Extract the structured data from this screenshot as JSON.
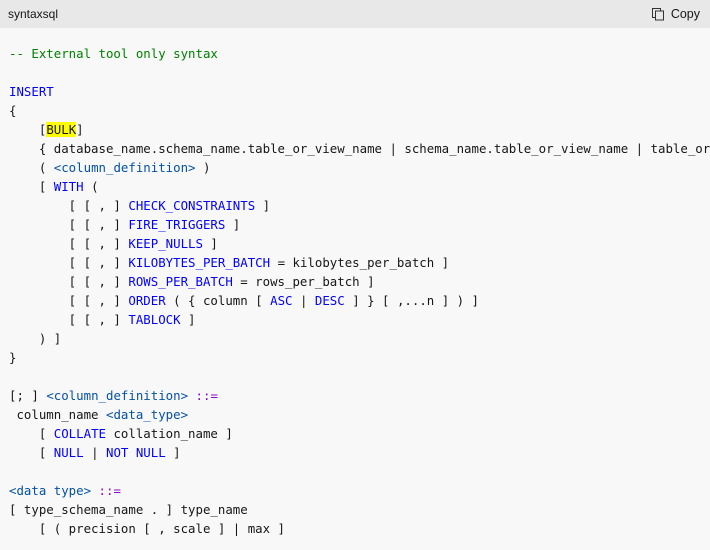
{
  "header": {
    "language": "syntaxsql",
    "copy_label": "Copy"
  },
  "icons": {
    "copy": "copy-icon"
  },
  "colors": {
    "comment": "#008000",
    "keyword": "#0101fd",
    "type": "#0451a5",
    "operator": "#8f08c4",
    "highlight": "#ffff00",
    "text": "#171717",
    "header_bg": "#e8e8e8",
    "code_bg": "#f8f8f8"
  },
  "code_lines": [
    [
      [
        "c",
        "-- External tool only syntax"
      ]
    ],
    [],
    [
      [
        "k",
        "INSERT"
      ]
    ],
    [
      [
        "t",
        "{"
      ]
    ],
    [
      [
        "t",
        "    ["
      ],
      [
        "h",
        "BULK"
      ],
      [
        "t",
        "]"
      ]
    ],
    [
      [
        "t",
        "    { database_name.schema_name.table_or_view_name | schema_name.table_or_view_name | table_or_view_name }"
      ]
    ],
    [
      [
        "t",
        "    ( "
      ],
      [
        "y",
        "<column_definition>"
      ],
      [
        "t",
        " )"
      ]
    ],
    [
      [
        "t",
        "    [ "
      ],
      [
        "k",
        "WITH"
      ],
      [
        "t",
        " ("
      ]
    ],
    [
      [
        "t",
        "        [ [ , ] "
      ],
      [
        "k",
        "CHECK_CONSTRAINTS"
      ],
      [
        "t",
        " ]"
      ]
    ],
    [
      [
        "t",
        "        [ [ , ] "
      ],
      [
        "k",
        "FIRE_TRIGGERS"
      ],
      [
        "t",
        " ]"
      ]
    ],
    [
      [
        "t",
        "        [ [ , ] "
      ],
      [
        "k",
        "KEEP_NULLS"
      ],
      [
        "t",
        " ]"
      ]
    ],
    [
      [
        "t",
        "        [ [ , ] "
      ],
      [
        "k",
        "KILOBYTES_PER_BATCH"
      ],
      [
        "t",
        " = kilobytes_per_batch ]"
      ]
    ],
    [
      [
        "t",
        "        [ [ , ] "
      ],
      [
        "k",
        "ROWS_PER_BATCH"
      ],
      [
        "t",
        " = rows_per_batch ]"
      ]
    ],
    [
      [
        "t",
        "        [ [ , ] "
      ],
      [
        "k",
        "ORDER"
      ],
      [
        "t",
        " ( { column [ "
      ],
      [
        "k",
        "ASC"
      ],
      [
        "t",
        " | "
      ],
      [
        "k",
        "DESC"
      ],
      [
        "t",
        " ] } [ ,...n ] ) ]"
      ]
    ],
    [
      [
        "t",
        "        [ [ , ] "
      ],
      [
        "k",
        "TABLOCK"
      ],
      [
        "t",
        " ]"
      ]
    ],
    [
      [
        "t",
        "    ) ]"
      ]
    ],
    [
      [
        "t",
        "}"
      ]
    ],
    [],
    [
      [
        "t",
        "[; ] "
      ],
      [
        "y",
        "<column_definition>"
      ],
      [
        "t",
        " "
      ],
      [
        "o",
        "::="
      ]
    ],
    [
      [
        "t",
        " column_name "
      ],
      [
        "y",
        "<data_type>"
      ]
    ],
    [
      [
        "t",
        "    [ "
      ],
      [
        "k",
        "COLLATE"
      ],
      [
        "t",
        " collation_name ]"
      ]
    ],
    [
      [
        "t",
        "    [ "
      ],
      [
        "k",
        "NULL"
      ],
      [
        "t",
        " | "
      ],
      [
        "k",
        "NOT NULL"
      ],
      [
        "t",
        " ]"
      ]
    ],
    [],
    [
      [
        "y",
        "<data type>"
      ],
      [
        "t",
        " "
      ],
      [
        "o",
        "::="
      ]
    ],
    [
      [
        "t",
        "[ type_schema_name . ] type_name"
      ]
    ],
    [
      [
        "t",
        "    [ ( precision [ , scale ] | max ]"
      ]
    ]
  ]
}
